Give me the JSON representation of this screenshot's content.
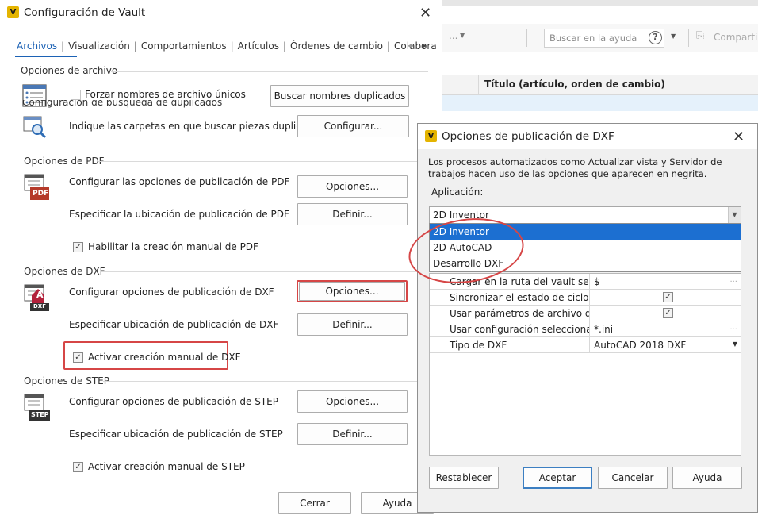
{
  "background_app": {
    "search_placeholder": "Buscar en la ayuda",
    "help_symbol": "?",
    "share_label": "Compartir",
    "column_title": "Título (artículo, orden de cambio)",
    "toolbar_fragment": "..."
  },
  "vault_dialog": {
    "title": "Configuración de Vault",
    "logo_letter": "V",
    "close_symbol": "✕",
    "tabs": [
      "Archivos",
      "Visualización",
      "Comportamientos",
      "Artículos",
      "Órdenes de cambio",
      "Colabora"
    ],
    "tab_scroll_left": "◂",
    "tab_scroll_right": "▸",
    "file_options": {
      "title": "Opciones de archivo",
      "force_unique_label": "Forzar nombres de archivo únicos",
      "force_unique_checked": false,
      "find_duplicates_button": "Buscar nombres duplicados",
      "duplicate_search_title": "Configuración de búsqueda de duplicados",
      "duplicate_folders_label": "Indique las carpetas en que buscar piezas duplicadas.",
      "configure_button": "Configurar..."
    },
    "pdf_options": {
      "title": "Opciones de PDF",
      "icon_text": "PDF",
      "configure_label": "Configurar las opciones de publicación de PDF",
      "options_button": "Opciones...",
      "location_label": "Especificar la ubicación de publicación de PDF",
      "define_button": "Definir...",
      "manual_label": "Habilitar la creación manual de PDF",
      "manual_checked": true
    },
    "dxf_options": {
      "title": "Opciones de DXF",
      "icon_text": "DXF",
      "configure_label": "Configurar opciones de publicación de DXF",
      "options_button": "Opciones...",
      "location_label": "Especificar ubicación de publicación de DXF",
      "define_button": "Definir...",
      "manual_label": "Activar creación manual de DXF",
      "manual_checked": true
    },
    "step_options": {
      "title": "Opciones de STEP",
      "icon_text": "STEP",
      "configure_label": "Configurar opciones de publicación de STEP",
      "options_button": "Opciones...",
      "location_label": "Especificar ubicación de publicación de STEP",
      "define_button": "Definir...",
      "manual_label": "Activar creación manual de STEP",
      "manual_checked": true
    },
    "close_button": "Cerrar",
    "help_button": "Ayuda"
  },
  "dxf_dialog": {
    "title": "Opciones de publicación de DXF",
    "logo_letter": "V",
    "close_symbol": "✕",
    "description": "Los procesos automatizados como Actualizar vista y Servidor de trabajos hacen uso de las opciones que aparecen en negrita.",
    "application_label": "Aplicación:",
    "application_value": "2D Inventor",
    "combo_arrow": "▼",
    "dropdown_options": [
      "2D Inventor",
      "2D AutoCAD",
      "Desarrollo DXF"
    ],
    "selected_option_index": 0,
    "grid_rows": [
      {
        "name": "Cargar en la ruta del vault selec...",
        "value": "$",
        "kind": "text",
        "disabled": true
      },
      {
        "name": "Sincronizar el estado de ciclo d...",
        "value": "",
        "kind": "checkbox",
        "checked": true,
        "disabled": false
      },
      {
        "name": "Usar parámetros de archivo de ...",
        "value": "",
        "kind": "checkbox",
        "checked": true,
        "disabled": false
      },
      {
        "name": "Usar configuración seleccionad...",
        "value": "*.ini",
        "kind": "text",
        "disabled": true
      },
      {
        "name": "Tipo de DXF",
        "value": "AutoCAD 2018 DXF",
        "kind": "select",
        "disabled": false
      }
    ],
    "ellipsis": "...",
    "reset_button": "Restablecer",
    "accept_button": "Aceptar",
    "cancel_button": "Cancelar",
    "help_button": "Ayuda"
  },
  "colors": {
    "accent": "#1c62b5",
    "selection": "#1c6fd1",
    "highlight_red": "#d64646",
    "vault_logo": "#e4b400"
  },
  "icons": [
    "vault-logo-icon",
    "file-list-icon",
    "magnifier-search-icon",
    "pdf-file-icon",
    "dxf-file-icon",
    "step-file-icon",
    "help-circle-icon",
    "share-icon"
  ]
}
